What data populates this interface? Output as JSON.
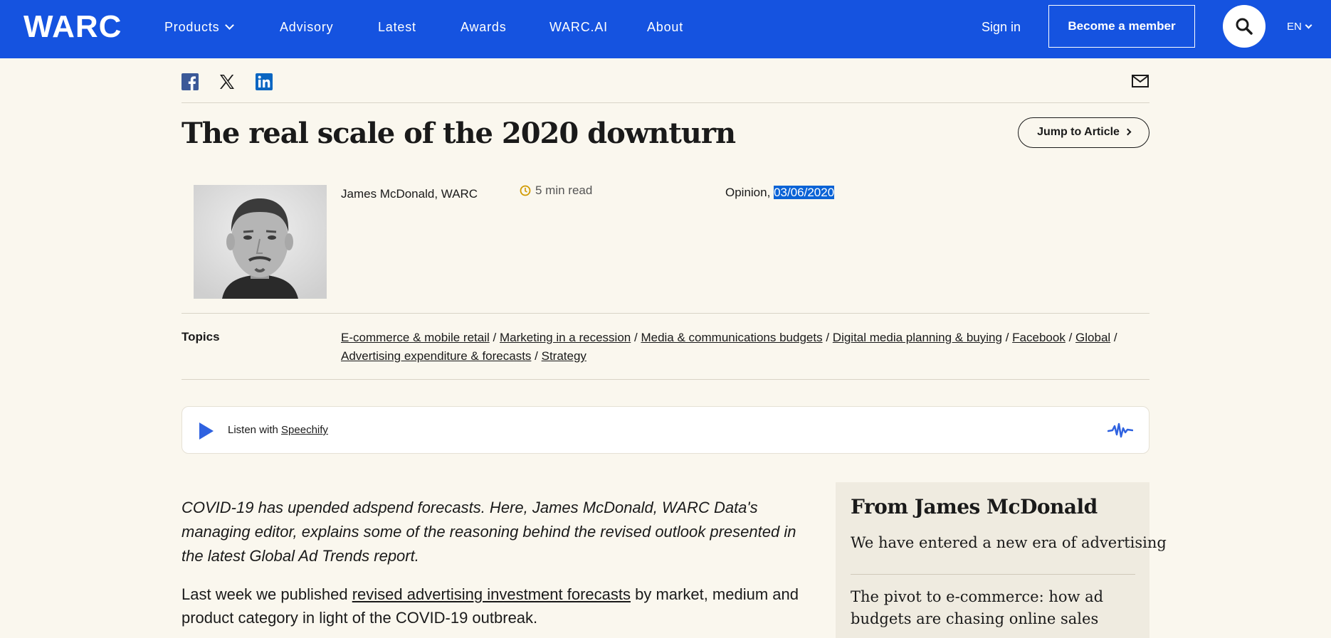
{
  "nav": {
    "logo": "WARC",
    "items": [
      {
        "label": "Products",
        "has_dropdown": true
      },
      {
        "label": "Advisory"
      },
      {
        "label": "Latest"
      },
      {
        "label": "Awards"
      },
      {
        "label": "WARC.AI"
      },
      {
        "label": "About"
      }
    ],
    "sign_in": "Sign in",
    "member_button": "Become a member",
    "language": "EN",
    "brand_color": "#1553e0"
  },
  "share": {
    "icons": [
      "facebook-icon",
      "x-icon",
      "linkedin-icon",
      "email-icon"
    ]
  },
  "article": {
    "title": "The real scale of the 2020 downturn",
    "jump_button": "Jump to Article",
    "author": "James McDonald, WARC",
    "read_time": "5 min read",
    "type": "Opinion,",
    "date": "03/06/2020",
    "topics_label": "Topics",
    "topics": [
      "E-commerce & mobile retail",
      "Marketing in a recession",
      "Media & communications budgets",
      "Digital media planning & buying",
      "Facebook",
      "Global",
      "Advertising expenditure & forecasts",
      "Strategy"
    ],
    "lede": "COVID-19 has upended adspend forecasts. Here, James McDonald, WARC Data's managing editor, explains some of the reasoning behind the revised outlook presented in the latest Global Ad Trends report.",
    "body_before_link": "Last week we published ",
    "body_link": "revised advertising investment forecasts",
    "body_after_link": " by market, medium and product category in light of the COVID-19 outbreak."
  },
  "speechify": {
    "prefix": "Listen with ",
    "link": "Speechify"
  },
  "sidebar": {
    "title": "From James McDonald",
    "links": [
      "We have entered a new era of advertising",
      "The pivot to e-commerce: how ad budgets are chasing online sales"
    ]
  }
}
